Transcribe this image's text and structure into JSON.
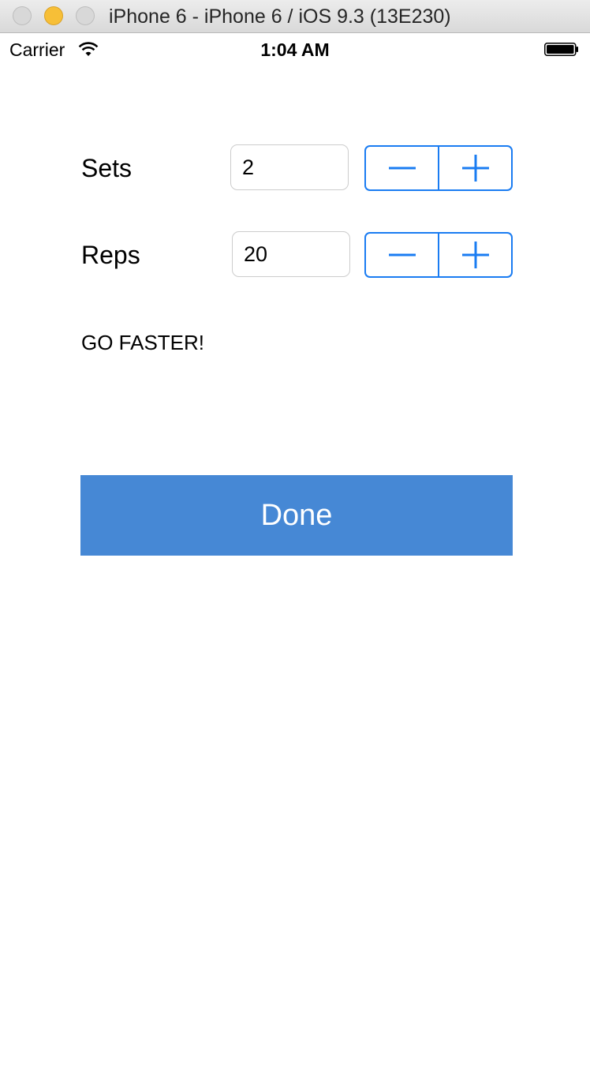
{
  "window": {
    "title": "iPhone 6 - iPhone 6 / iOS 9.3 (13E230)"
  },
  "status_bar": {
    "carrier": "Carrier",
    "time": "1:04 AM",
    "wifi_icon": "wifi-icon",
    "battery_icon": "battery-icon"
  },
  "sets": {
    "label": "Sets",
    "value": "2"
  },
  "reps": {
    "label": "Reps",
    "value": "20"
  },
  "message": "GO FASTER!",
  "done_label": "Done",
  "colors": {
    "accent": "#1a7cf2",
    "done_button": "#4688d5"
  }
}
